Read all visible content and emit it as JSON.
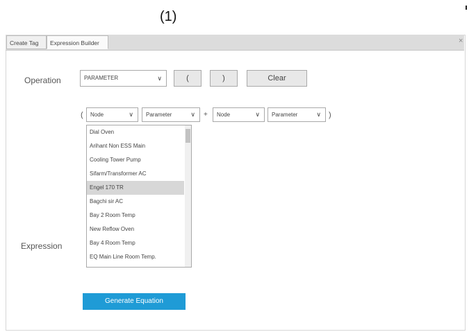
{
  "figure_label": "(1)",
  "tabs": [
    {
      "label": "Create Tag"
    },
    {
      "label": "Expression Builder"
    }
  ],
  "close_glyph": "×",
  "operation": {
    "label": "Operation",
    "selected": "PARAMETER",
    "open_paren_label": "(",
    "close_paren_label": ")",
    "clear_label": "Clear"
  },
  "expression_row": {
    "open_paren": "(",
    "close_paren": ")",
    "operator": "+",
    "node1": "Node",
    "param1": "Parameter",
    "node2": "Node",
    "param2": "Parameter",
    "dropdown_arrow": "∨"
  },
  "dropdown": {
    "items": [
      {
        "label": "Dial Oven"
      },
      {
        "label": "Arihant Non ESS Main"
      },
      {
        "label": "Cooling Tower Pump"
      },
      {
        "label": "Sifarm/Transformer AC"
      },
      {
        "label": "Engel 170 TR"
      },
      {
        "label": "Bagchi sir AC"
      },
      {
        "label": "Bay 2 Room Temp"
      },
      {
        "label": "New Reflow Oven"
      },
      {
        "label": "Bay 4 Room Temp"
      },
      {
        "label": "EQ Main Line Room Temp."
      }
    ],
    "selected_index": 4
  },
  "expression_label": "Expression",
  "generate_label": "Generate Equation",
  "colors": {
    "accent": "#1f9bd6",
    "tabbar": "#dcdcdc",
    "selected_item": "#d7d7d7"
  }
}
